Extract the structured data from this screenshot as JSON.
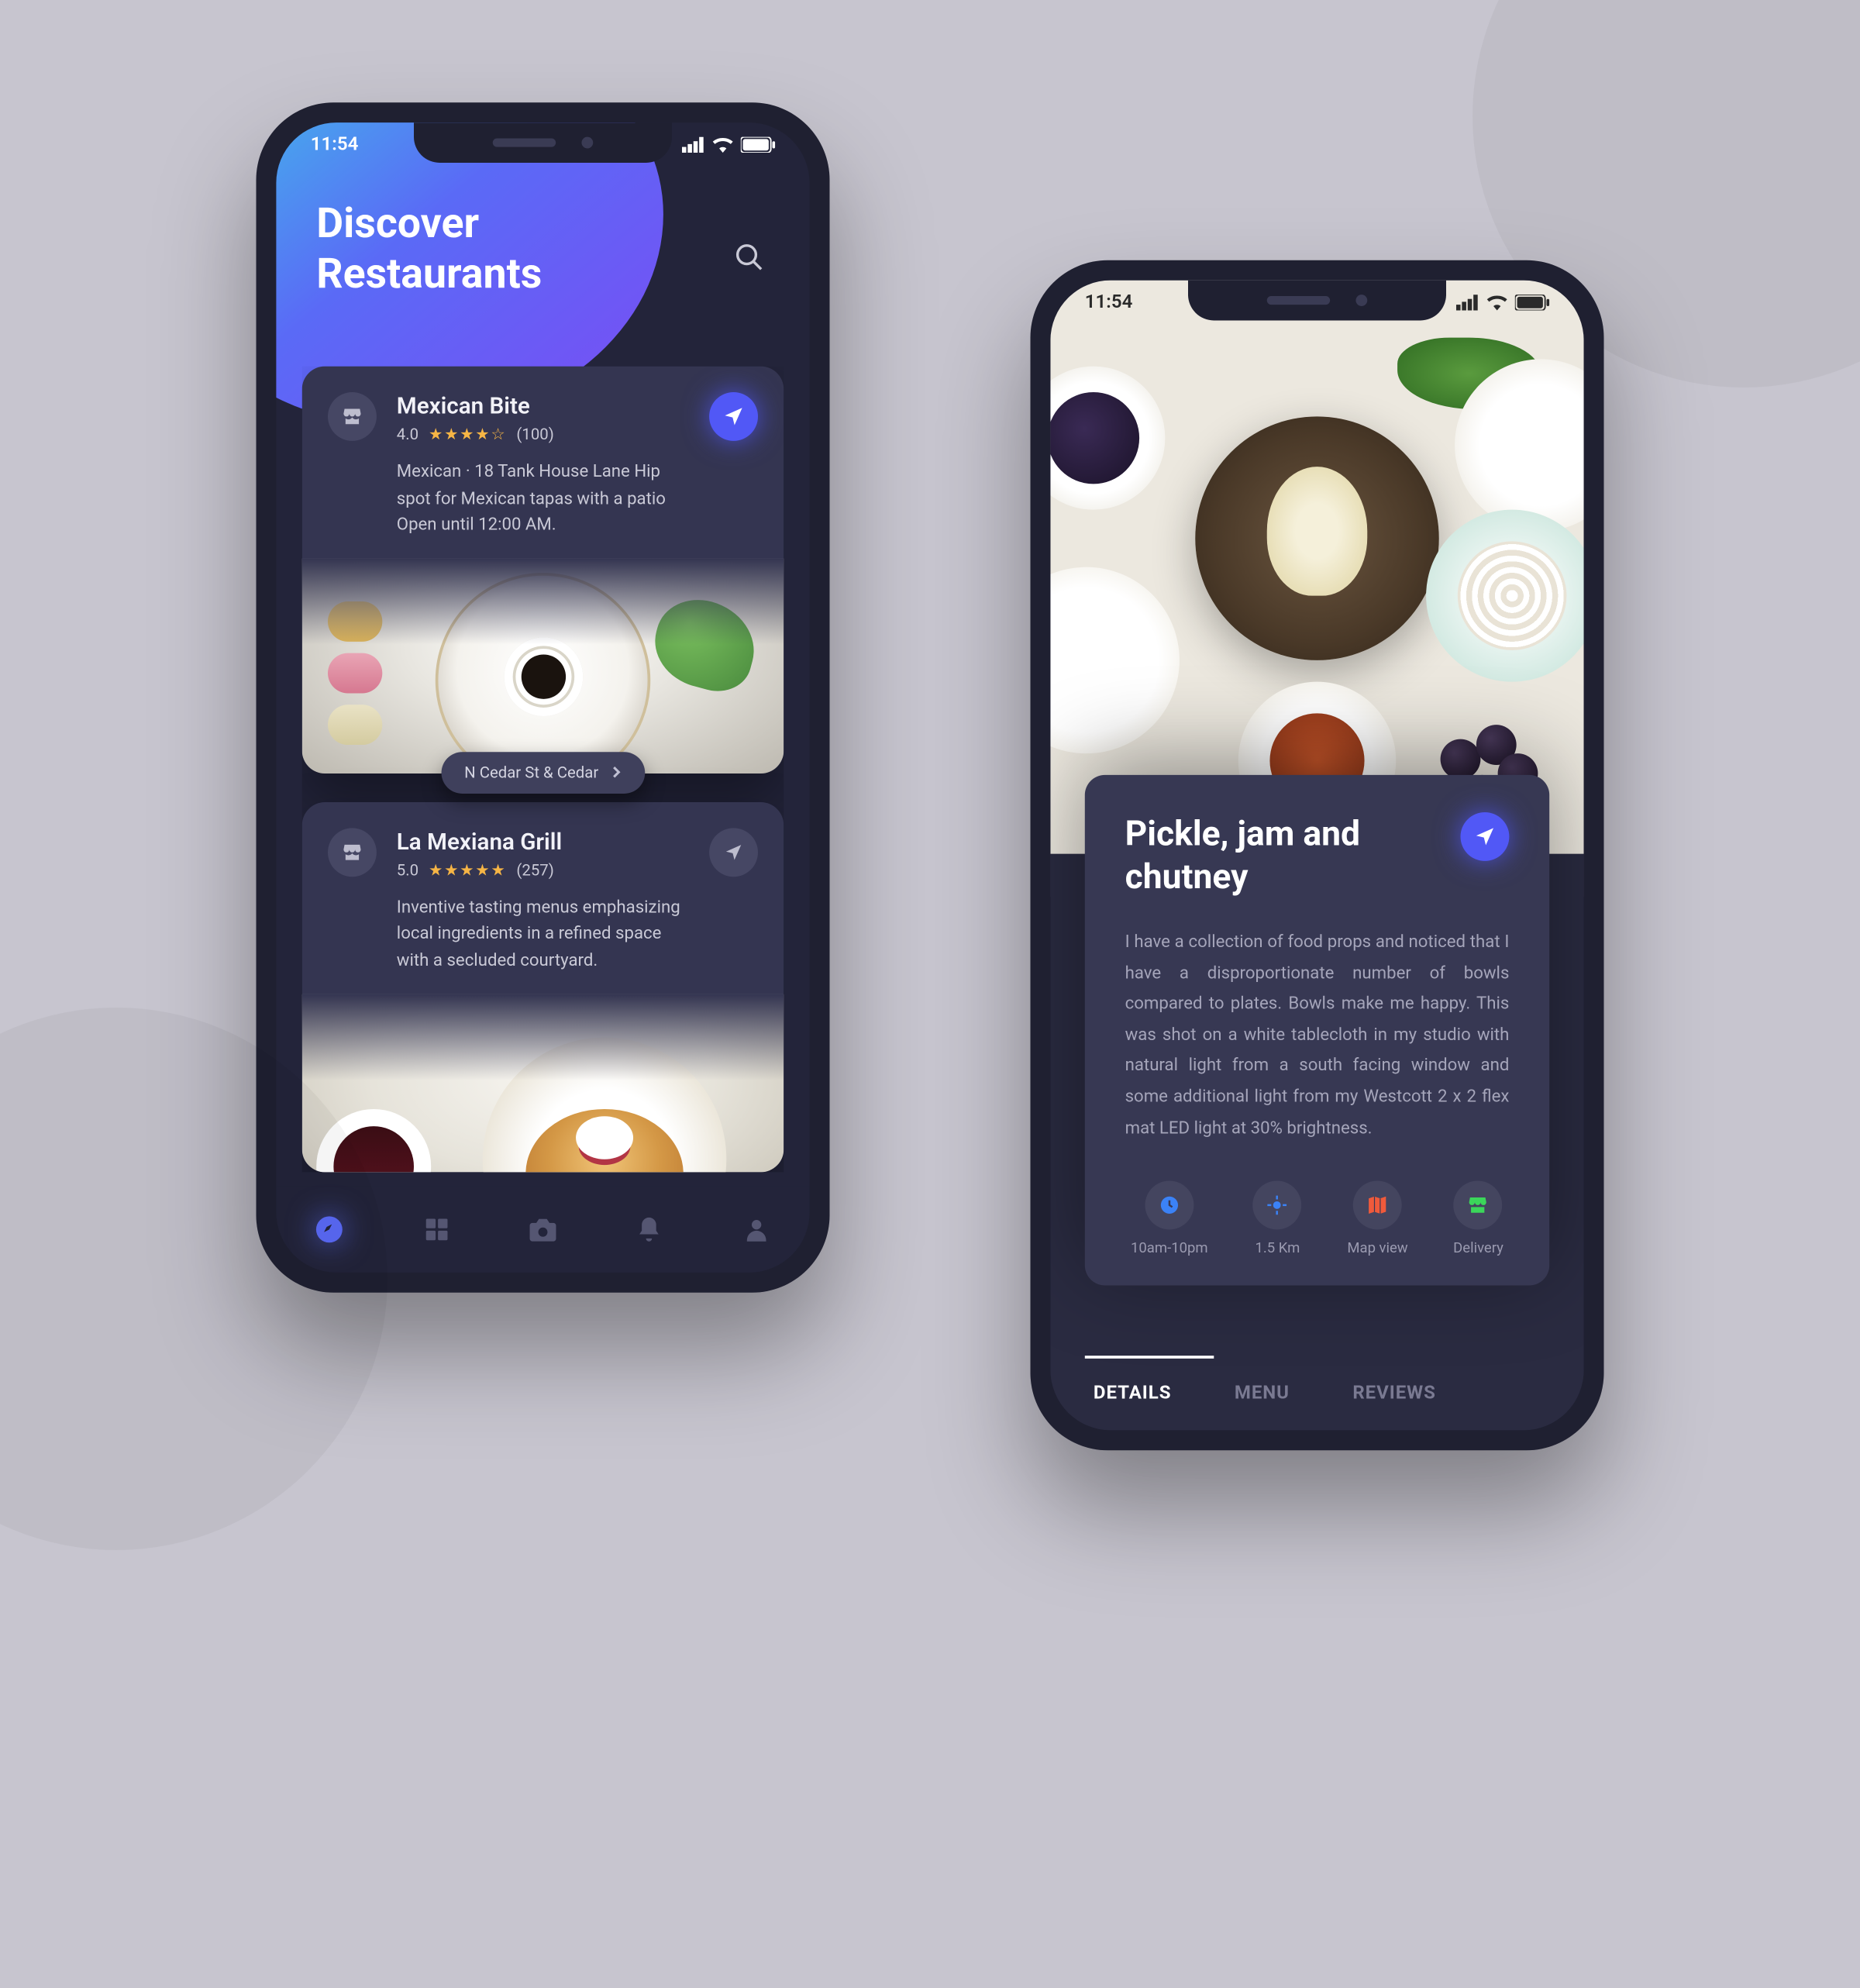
{
  "status": {
    "time": "11:54"
  },
  "screen1": {
    "title_line1": "Discover",
    "title_line2": "Restaurants",
    "cards": [
      {
        "name": "Mexican Bite",
        "rating": "4.0",
        "stars": "★★★★☆",
        "reviews": "(100)",
        "desc": "Mexican · 18 Tank House Lane Hip spot for Mexican tapas with a patio Open until 12:00 AM.",
        "location_chip": "N Cedar St & Cedar"
      },
      {
        "name": "La Mexiana Grill",
        "rating": "5.0",
        "stars": "★★★★★",
        "reviews": "(257)",
        "desc": "Inventive tasting menus emphasizing local ingredients in a refined space with a secluded courtyard."
      }
    ]
  },
  "screen2": {
    "title": "Pickle, jam and chutney",
    "desc": "I have a collection of food props and noticed that I have a disproportionate number of bowls compared to plates. Bowls make me happy. This was shot on a white tablecloth in my studio with natural light from a south facing window and some additional light from my Westcott 2 x 2 flex mat LED light at 30% brightness.",
    "info": [
      {
        "label": "10am-10pm"
      },
      {
        "label": "1.5 Km"
      },
      {
        "label": "Map view"
      },
      {
        "label": "Delivery"
      }
    ],
    "tabs": {
      "details": "DETAILS",
      "menu": "MENU",
      "reviews": "REVIEWS"
    }
  }
}
